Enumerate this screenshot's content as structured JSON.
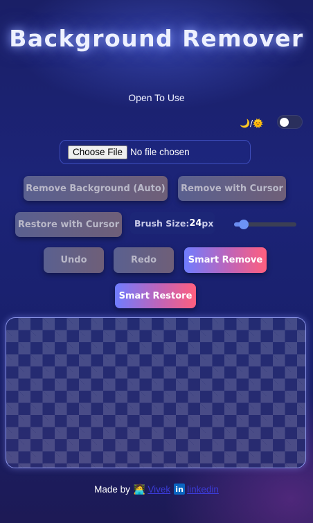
{
  "header": {
    "title": "Background Remover",
    "subtitle": "Open To Use"
  },
  "theme": {
    "label": "🌙/🌞",
    "toggle_on": false
  },
  "upload": {
    "button_label": "Choose File",
    "status": "No file chosen"
  },
  "actions": {
    "remove_auto": "Remove Background (Auto)",
    "remove_cursor": "Remove with Cursor",
    "restore_cursor": "Restore with Cursor",
    "undo": "Undo",
    "redo": "Redo",
    "smart_remove": "Smart Remove",
    "smart_restore": "Smart Restore"
  },
  "brush": {
    "label": "Brush Size: ",
    "value": "24",
    "unit": "px",
    "slider_fraction": 0.09
  },
  "footer": {
    "made_by": "Made by",
    "person_icon": "🧑‍💻",
    "author_link": "Vivek",
    "linkedin_icon_text": "in",
    "linkedin_link": "linkedin"
  },
  "colors": {
    "accent_start": "#6f7dff",
    "accent_end": "#ff5f7e",
    "background": "#1c2478"
  }
}
